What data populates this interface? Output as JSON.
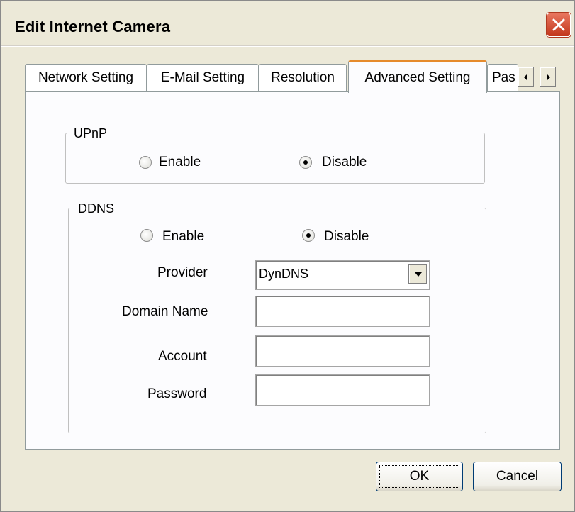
{
  "window": {
    "title": "Edit Internet Camera"
  },
  "tabs": [
    {
      "label": "Network Setting"
    },
    {
      "label": "E-Mail Setting"
    },
    {
      "label": "Resolution"
    },
    {
      "label": "Advanced Setting",
      "active": true
    },
    {
      "label": "Pas"
    }
  ],
  "upnp": {
    "group_label": "UPnP",
    "enable_label": "Enable",
    "disable_label": "Disable",
    "selected": "Disable"
  },
  "ddns": {
    "group_label": "DDNS",
    "enable_label": "Enable",
    "disable_label": "Disable",
    "selected": "Disable",
    "provider_label": "Provider",
    "provider_value": "DynDNS",
    "domain_label": "Domain Name",
    "domain_value": "",
    "account_label": "Account",
    "account_value": "",
    "password_label": "Password",
    "password_value": ""
  },
  "buttons": {
    "ok_label": "OK",
    "cancel_label": "Cancel"
  },
  "icons": {
    "close": "close-icon",
    "tab_left": "arrow-left-icon",
    "tab_right": "arrow-right-icon",
    "dropdown": "chevron-down-icon"
  }
}
